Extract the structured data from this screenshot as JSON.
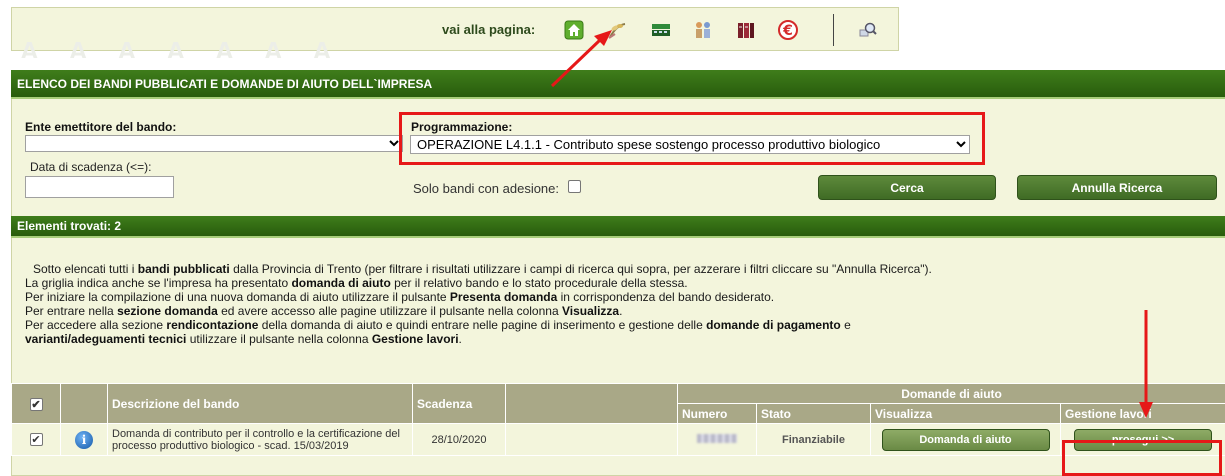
{
  "nav": {
    "label": "vai alla pagina:",
    "icons": [
      "home-icon",
      "sprout-icon",
      "cash-register-icon",
      "people-icon",
      "books-icon",
      "euro-icon",
      "magnifier-icon"
    ]
  },
  "ghost_text": "AAAAAAA",
  "panel": {
    "title": "ELENCO DEI BANDI PUBBLICATI E DOMANDE DI AIUTO DELL`IMPRESA"
  },
  "filters": {
    "ente_label": "Ente emettitore del bando:",
    "ente_value": "",
    "programmazione_label": "Programmazione:",
    "programmazione_value": "OPERAZIONE L4.1.1 - Contributo spese sostengo processo produttivo biologico",
    "data_label": "Data di scadenza (<=):",
    "data_value": "",
    "solo_bandi_label": "Solo bandi con adesione:",
    "cerca_label": "Cerca",
    "annulla_label": "Annulla Ricerca"
  },
  "results": {
    "header": "Elementi trovati: 2"
  },
  "instructions": {
    "l1_pre": "Sotto elencati tutti i ",
    "l1_b": "bandi pubblicati",
    "l1_post": " dalla Provincia di Trento (per filtrare i risultati utilizzare i campi di ricerca qui sopra, per azzerare i filtri cliccare su \"Annulla Ricerca\").",
    "l2_pre": "La griglia indica anche se l'impresa ha presentato ",
    "l2_b": "domanda di aiuto",
    "l2_post": " per il relativo bando  e lo stato procedurale della stessa.",
    "l3_pre": "Per iniziare la compilazione di una nuova domanda di aiuto utilizzare il pulsante ",
    "l3_b": "Presenta domanda",
    "l3_post": " in corrispondenza del bando desiderato.",
    "l4_pre": "Per entrare nella ",
    "l4_b": "sezione domanda",
    "l4_mid": " ed avere accesso alle pagine utilizzare il pulsante nella colonna ",
    "l4_b2": "Visualizza",
    "l4_post": ".",
    "l5_pre": "Per accedere alla sezione ",
    "l5_b": "rendicontazione",
    "l5_mid": " della domanda di aiuto e quindi entrare nelle pagine di inserimento e gestione delle  ",
    "l5_b2": "domande di pagamento",
    "l5_post": " e",
    "l6_b": "varianti/adeguamenti tecnici",
    "l6_mid": " utilizzare il pulsante nella colonna ",
    "l6_b2": "Gestione lavori",
    "l6_post": "."
  },
  "table": {
    "col_descrizione": "Descrizione del bando",
    "col_scadenza": "Scadenza",
    "col_domande": "Domande di aiuto",
    "col_numero": "Numero",
    "col_stato": "Stato",
    "col_visualizza": "Visualizza",
    "col_gestione": "Gestione lavori",
    "rows": [
      {
        "descrizione": "Domanda di contributo per il controllo e la certificazione del processo produttivo biologico - scad. 15/03/2019",
        "scadenza": "28/10/2020",
        "stato": "Finanziabile",
        "visualizza_label": "Domanda di aiuto",
        "gestione_label": "prosegui >>"
      }
    ]
  },
  "colors": {
    "header_green": "#2f6a12",
    "panel_bg": "#f3f5dc",
    "table_header": "#a9a887",
    "annotation_red": "#e61818"
  }
}
